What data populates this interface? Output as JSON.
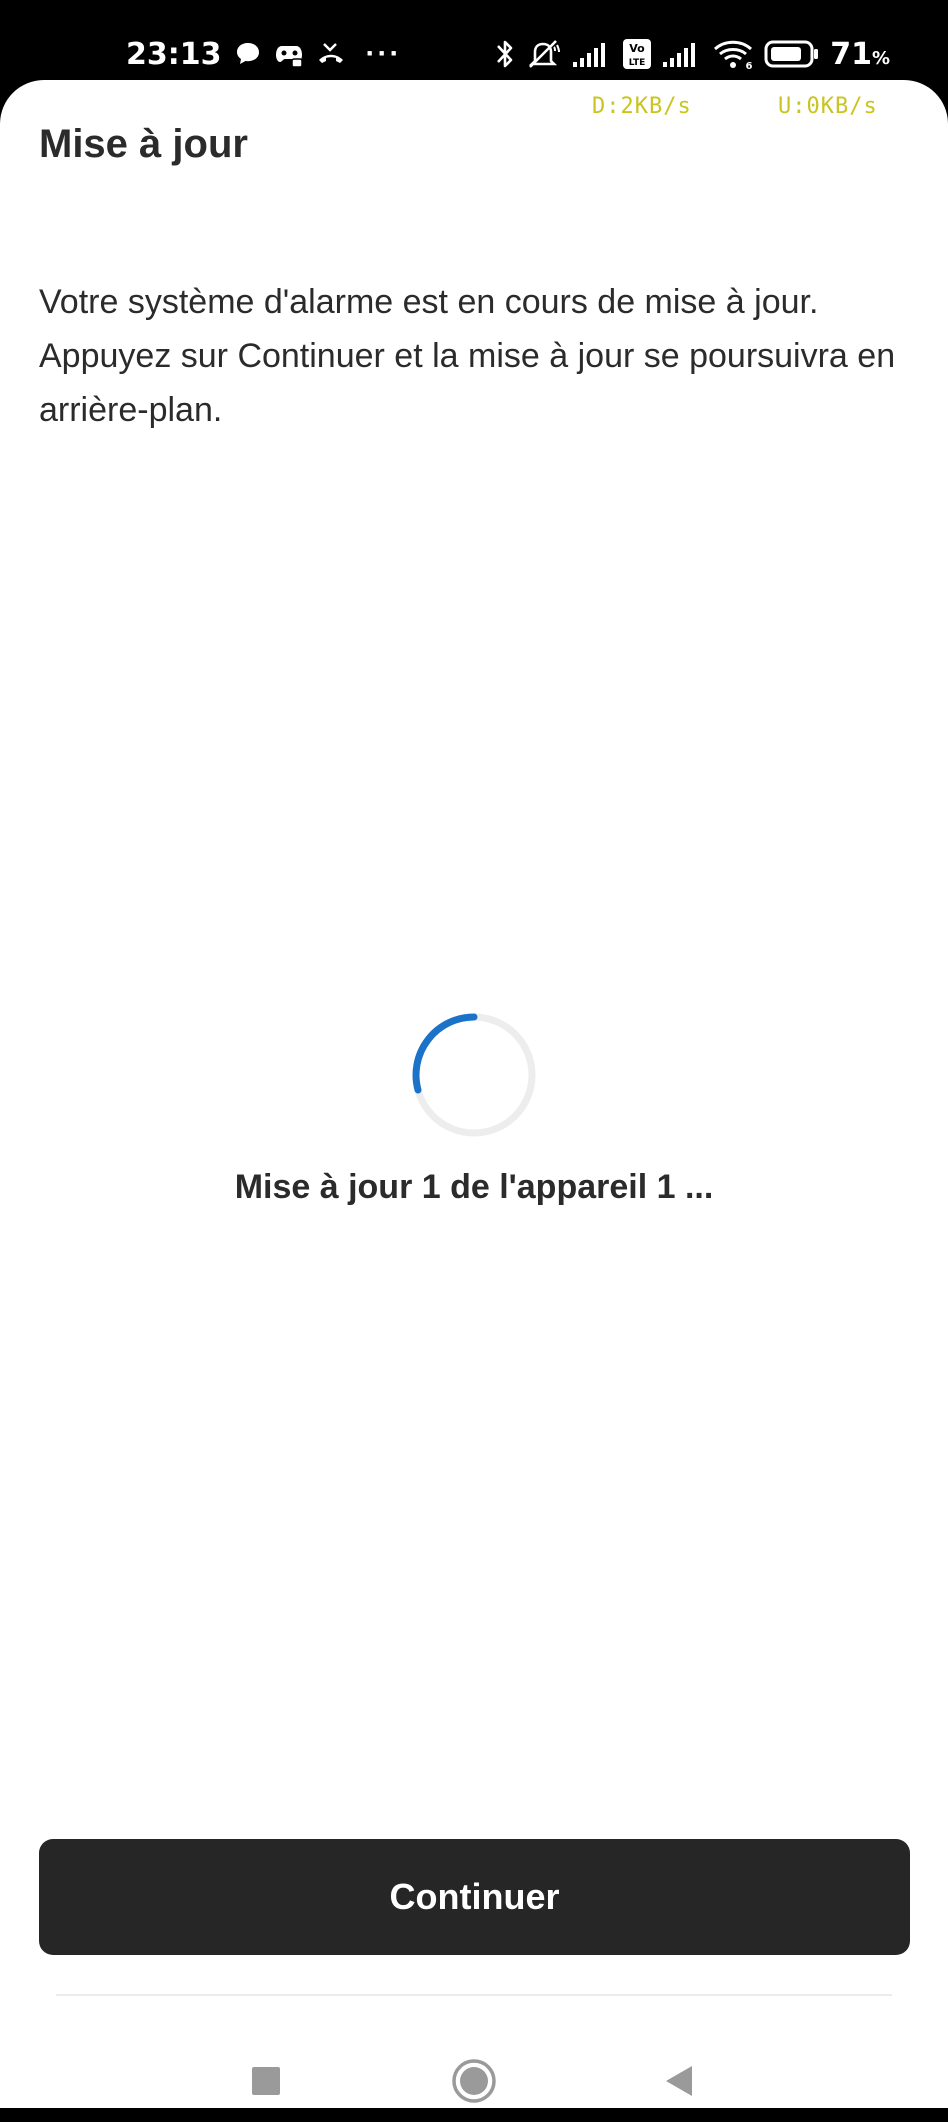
{
  "status_bar": {
    "time": "23:13",
    "battery_percent": "71",
    "battery_unit": "%",
    "icons_left": [
      "chat-bubble-icon",
      "gamepad-icon",
      "missed-call-icon",
      "more-dots-icon"
    ],
    "icons_right": [
      "bluetooth-icon",
      "bell-off-icon",
      "signal-icon",
      "volte-icon",
      "signal-icon",
      "wifi-icon",
      "battery-icon"
    ],
    "volte_label_top": "Vo",
    "volte_label_bottom": "LTE",
    "wifi_label": "6",
    "more_dots": "···"
  },
  "network_speed": {
    "download": "D:2KB/s",
    "upload": "U:0KB/s"
  },
  "page": {
    "title": "Mise à jour",
    "description": "Votre système d'alarme est en cours de mise à jour. Appuyez sur Continuer et la mise à jour se poursuivra en arrière-plan.",
    "progress_text": "Mise à jour 1 de l'appareil 1 ...",
    "continue_label": "Continuer"
  },
  "colors": {
    "spinner_accent": "#1a73c8",
    "spinner_track": "#ededed",
    "button_bg": "#262626",
    "text": "#2b2b2b"
  },
  "nav_bar": {
    "buttons": [
      "recents-icon",
      "home-icon",
      "back-icon"
    ]
  }
}
